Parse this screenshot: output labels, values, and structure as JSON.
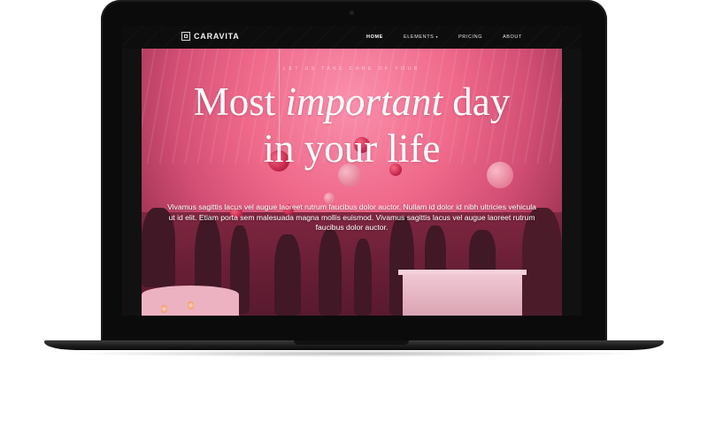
{
  "brand": {
    "name": "CARAVITA",
    "icon": "grid-square-icon"
  },
  "nav": {
    "items": [
      {
        "label": "HOME",
        "active": true
      },
      {
        "label": "ELEMENTS",
        "has_dropdown": true,
        "caret": "▾"
      },
      {
        "label": "PRICING"
      },
      {
        "label": "ABOUT"
      }
    ]
  },
  "hero": {
    "subheading": "LET US TAKE CARE OF YOUR",
    "title_line1_start": "Most ",
    "title_line1_emphasis": "important",
    "title_line1_end": " day",
    "title_line2": "in your life",
    "body": "Vivamus sagittis lacus vel augue laoreet rutrum faucibus dolor auctor. Nullam id dolor id nibh ultricies vehicula ut id elit. Etiam porta sem malesuada magna mollis euismod. Vivamus sagittis lacus vel augue laoreet rutrum faucibus dolor auctor.",
    "colors": {
      "overlay": "#e65078",
      "text": "#ffffff"
    }
  },
  "device": {
    "frame_color": "#0b0b0c"
  }
}
